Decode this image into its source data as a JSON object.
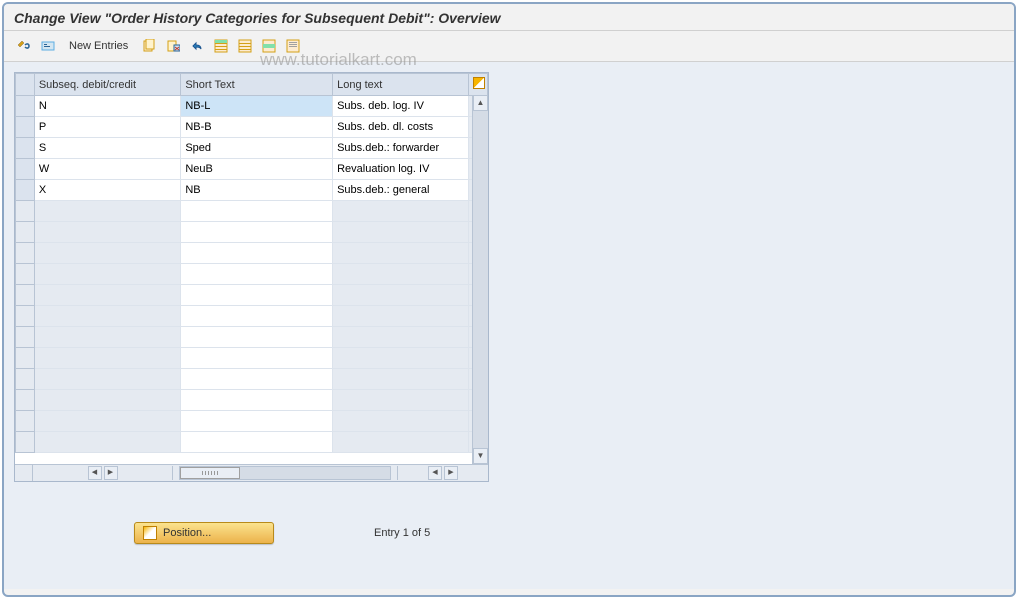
{
  "title": "Change View \"Order History Categories for Subsequent Debit\": Overview",
  "watermark": "www.tutorialkart.com",
  "toolbar": {
    "new_entries": "New Entries"
  },
  "table": {
    "headers": {
      "col1": "Subseq. debit/credit",
      "col2": "Short Text",
      "col3": "Long text"
    },
    "rows": [
      {
        "code": "N",
        "short": "NB-L",
        "long": "Subs. deb. log. IV"
      },
      {
        "code": "P",
        "short": "NB-B",
        "long": "Subs. deb. dl. costs"
      },
      {
        "code": "S",
        "short": "Sped",
        "long": "Subs.deb.: forwarder"
      },
      {
        "code": "W",
        "short": "NeuB",
        "long": "Revaluation log. IV"
      },
      {
        "code": "X",
        "short": "NB",
        "long": "Subs.deb.: general"
      }
    ]
  },
  "footer": {
    "position_label": "Position...",
    "entry_text": "Entry 1 of 5"
  }
}
